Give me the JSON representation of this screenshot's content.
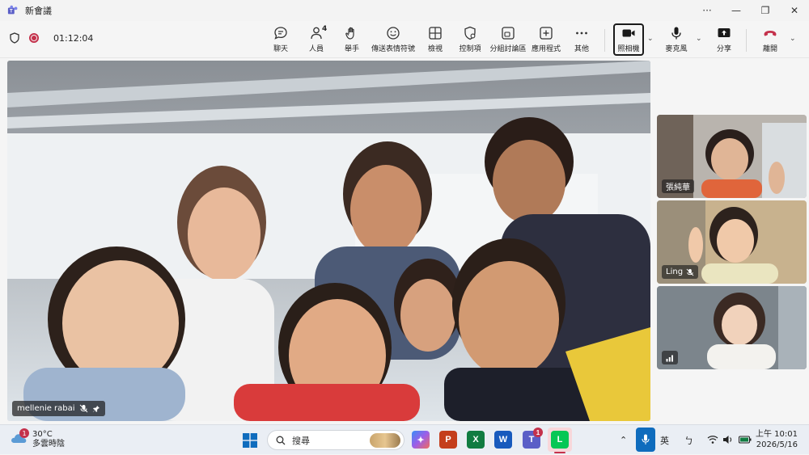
{
  "window": {
    "title": "新會議"
  },
  "meeting": {
    "timer": "01:12:04",
    "people_count": "4",
    "toolbar": {
      "chat": "聊天",
      "people": "人員",
      "raise": "舉手",
      "react": "傳送表情符號",
      "view": "檢視",
      "control": "控制項",
      "rooms": "分組討論區",
      "apps": "應用程式",
      "more": "其他",
      "camera": "照相機",
      "mic": "麥克風",
      "share": "分享",
      "leave": "離開"
    }
  },
  "participants": {
    "main": "mellenie rabai",
    "thumb1": "張純華",
    "thumb2": "Ling",
    "thumb3": ""
  },
  "taskbar": {
    "temperature": "30°C",
    "weather_desc": "多雲時陰",
    "weather_badge": "1",
    "search_placeholder": "搜尋",
    "teams_badge": "1",
    "ime_lang": "英",
    "time": "上午 10:01",
    "date": "2026/5/16"
  },
  "colors": {
    "accent": "#5b5fc7",
    "leave": "#c4314b",
    "record": "#c4314b"
  }
}
